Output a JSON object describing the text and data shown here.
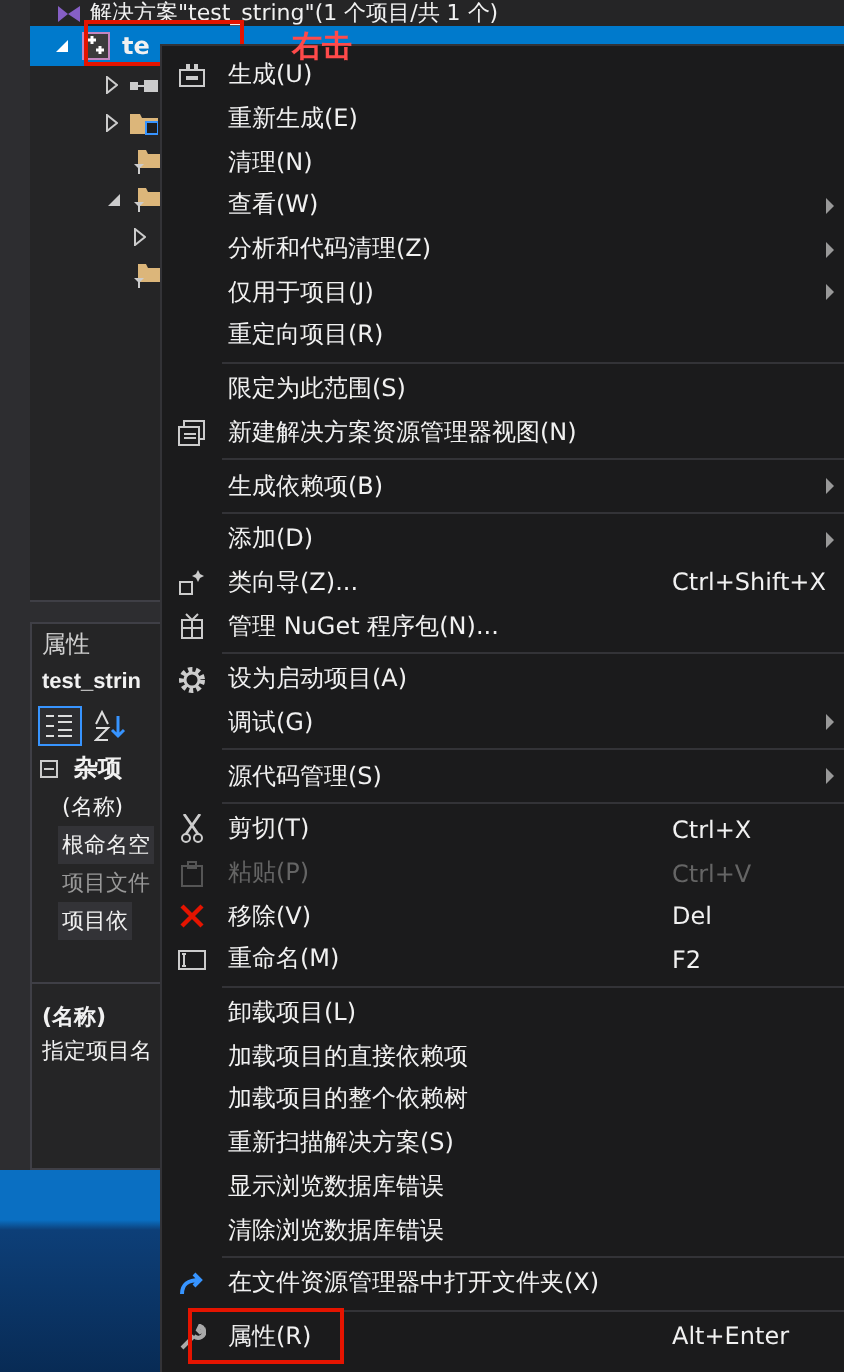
{
  "solution_tree": {
    "solution_row": {
      "label": "解决方案\"test_string\"(1 个项目/共 1 个)"
    },
    "project_row": {
      "label": "te",
      "selected": true,
      "expanded": true,
      "boxed": true
    },
    "items": [
      {
        "kind": "references",
        "expanded": false
      },
      {
        "kind": "linked-folder",
        "expanded": false
      },
      {
        "kind": "filter-folder"
      },
      {
        "kind": "filter-folder",
        "expanded": true,
        "children": [
          {
            "expanded": false
          }
        ]
      },
      {
        "kind": "filter-folder"
      }
    ]
  },
  "callout": "右击",
  "properties": {
    "title": "属性",
    "object": "test_strin",
    "category": {
      "label": "杂项",
      "expanded": true
    },
    "rows": [
      {
        "label": "(名称)",
        "disabled": false,
        "shaded": false
      },
      {
        "label": "根命名空",
        "disabled": false,
        "shaded": true
      },
      {
        "label": "项目文件",
        "disabled": true,
        "shaded": false
      },
      {
        "label": "项目依",
        "disabled": false,
        "shaded": true
      }
    ],
    "description": {
      "title": "(名称)",
      "text": "指定项目名"
    }
  },
  "context_menu": {
    "groups": [
      [
        {
          "label": "生成(U)",
          "kind": "build"
        },
        {
          "label": "重新生成(E)"
        },
        {
          "label": "清理(N)"
        },
        {
          "label": "查看(W)",
          "submenu": true
        },
        {
          "label": "分析和代码清理(Z)",
          "submenu": true
        },
        {
          "label": "仅用于项目(J)",
          "submenu": true
        },
        {
          "label": "重定向项目(R)"
        }
      ],
      [
        {
          "label": "限定为此范围(S)"
        },
        {
          "label": "新建解决方案资源管理器视图(N)",
          "kind": "new-view"
        }
      ],
      [
        {
          "label": "生成依赖项(B)",
          "submenu": true
        }
      ],
      [
        {
          "label": "添加(D)",
          "submenu": true
        },
        {
          "label": "类向导(Z)...",
          "kind": "wizard",
          "shortcut": "Ctrl+Shift+X"
        },
        {
          "label": "管理 NuGet 程序包(N)...",
          "kind": "package"
        }
      ],
      [
        {
          "label": "设为启动项目(A)",
          "kind": "gear"
        },
        {
          "label": "调试(G)",
          "submenu": true
        }
      ],
      [
        {
          "label": "源代码管理(S)",
          "submenu": true
        }
      ],
      [
        {
          "label": "剪切(T)",
          "kind": "scissors",
          "shortcut": "Ctrl+X",
          "disabled": false
        },
        {
          "label": "粘贴(P)",
          "kind": "paste",
          "shortcut": "Ctrl+V",
          "disabled": true
        },
        {
          "label": "移除(V)",
          "kind": "remove",
          "shortcut": "Del",
          "disabled": false
        },
        {
          "label": "重命名(M)",
          "kind": "rename",
          "shortcut": "F2",
          "disabled": false
        }
      ],
      [
        {
          "label": "卸载项目(L)"
        },
        {
          "label": "加载项目的直接依赖项"
        },
        {
          "label": "加载项目的整个依赖树"
        },
        {
          "label": "重新扫描解决方案(S)"
        },
        {
          "label": "显示浏览数据库错误"
        },
        {
          "label": "清除浏览数据库错误"
        }
      ],
      [
        {
          "label": "在文件资源管理器中打开文件夹(X)",
          "kind": "open-folder"
        }
      ],
      [
        {
          "label": "属性(R)",
          "kind": "wrench",
          "shortcut": "Alt+Enter",
          "boxed": true
        }
      ]
    ]
  }
}
